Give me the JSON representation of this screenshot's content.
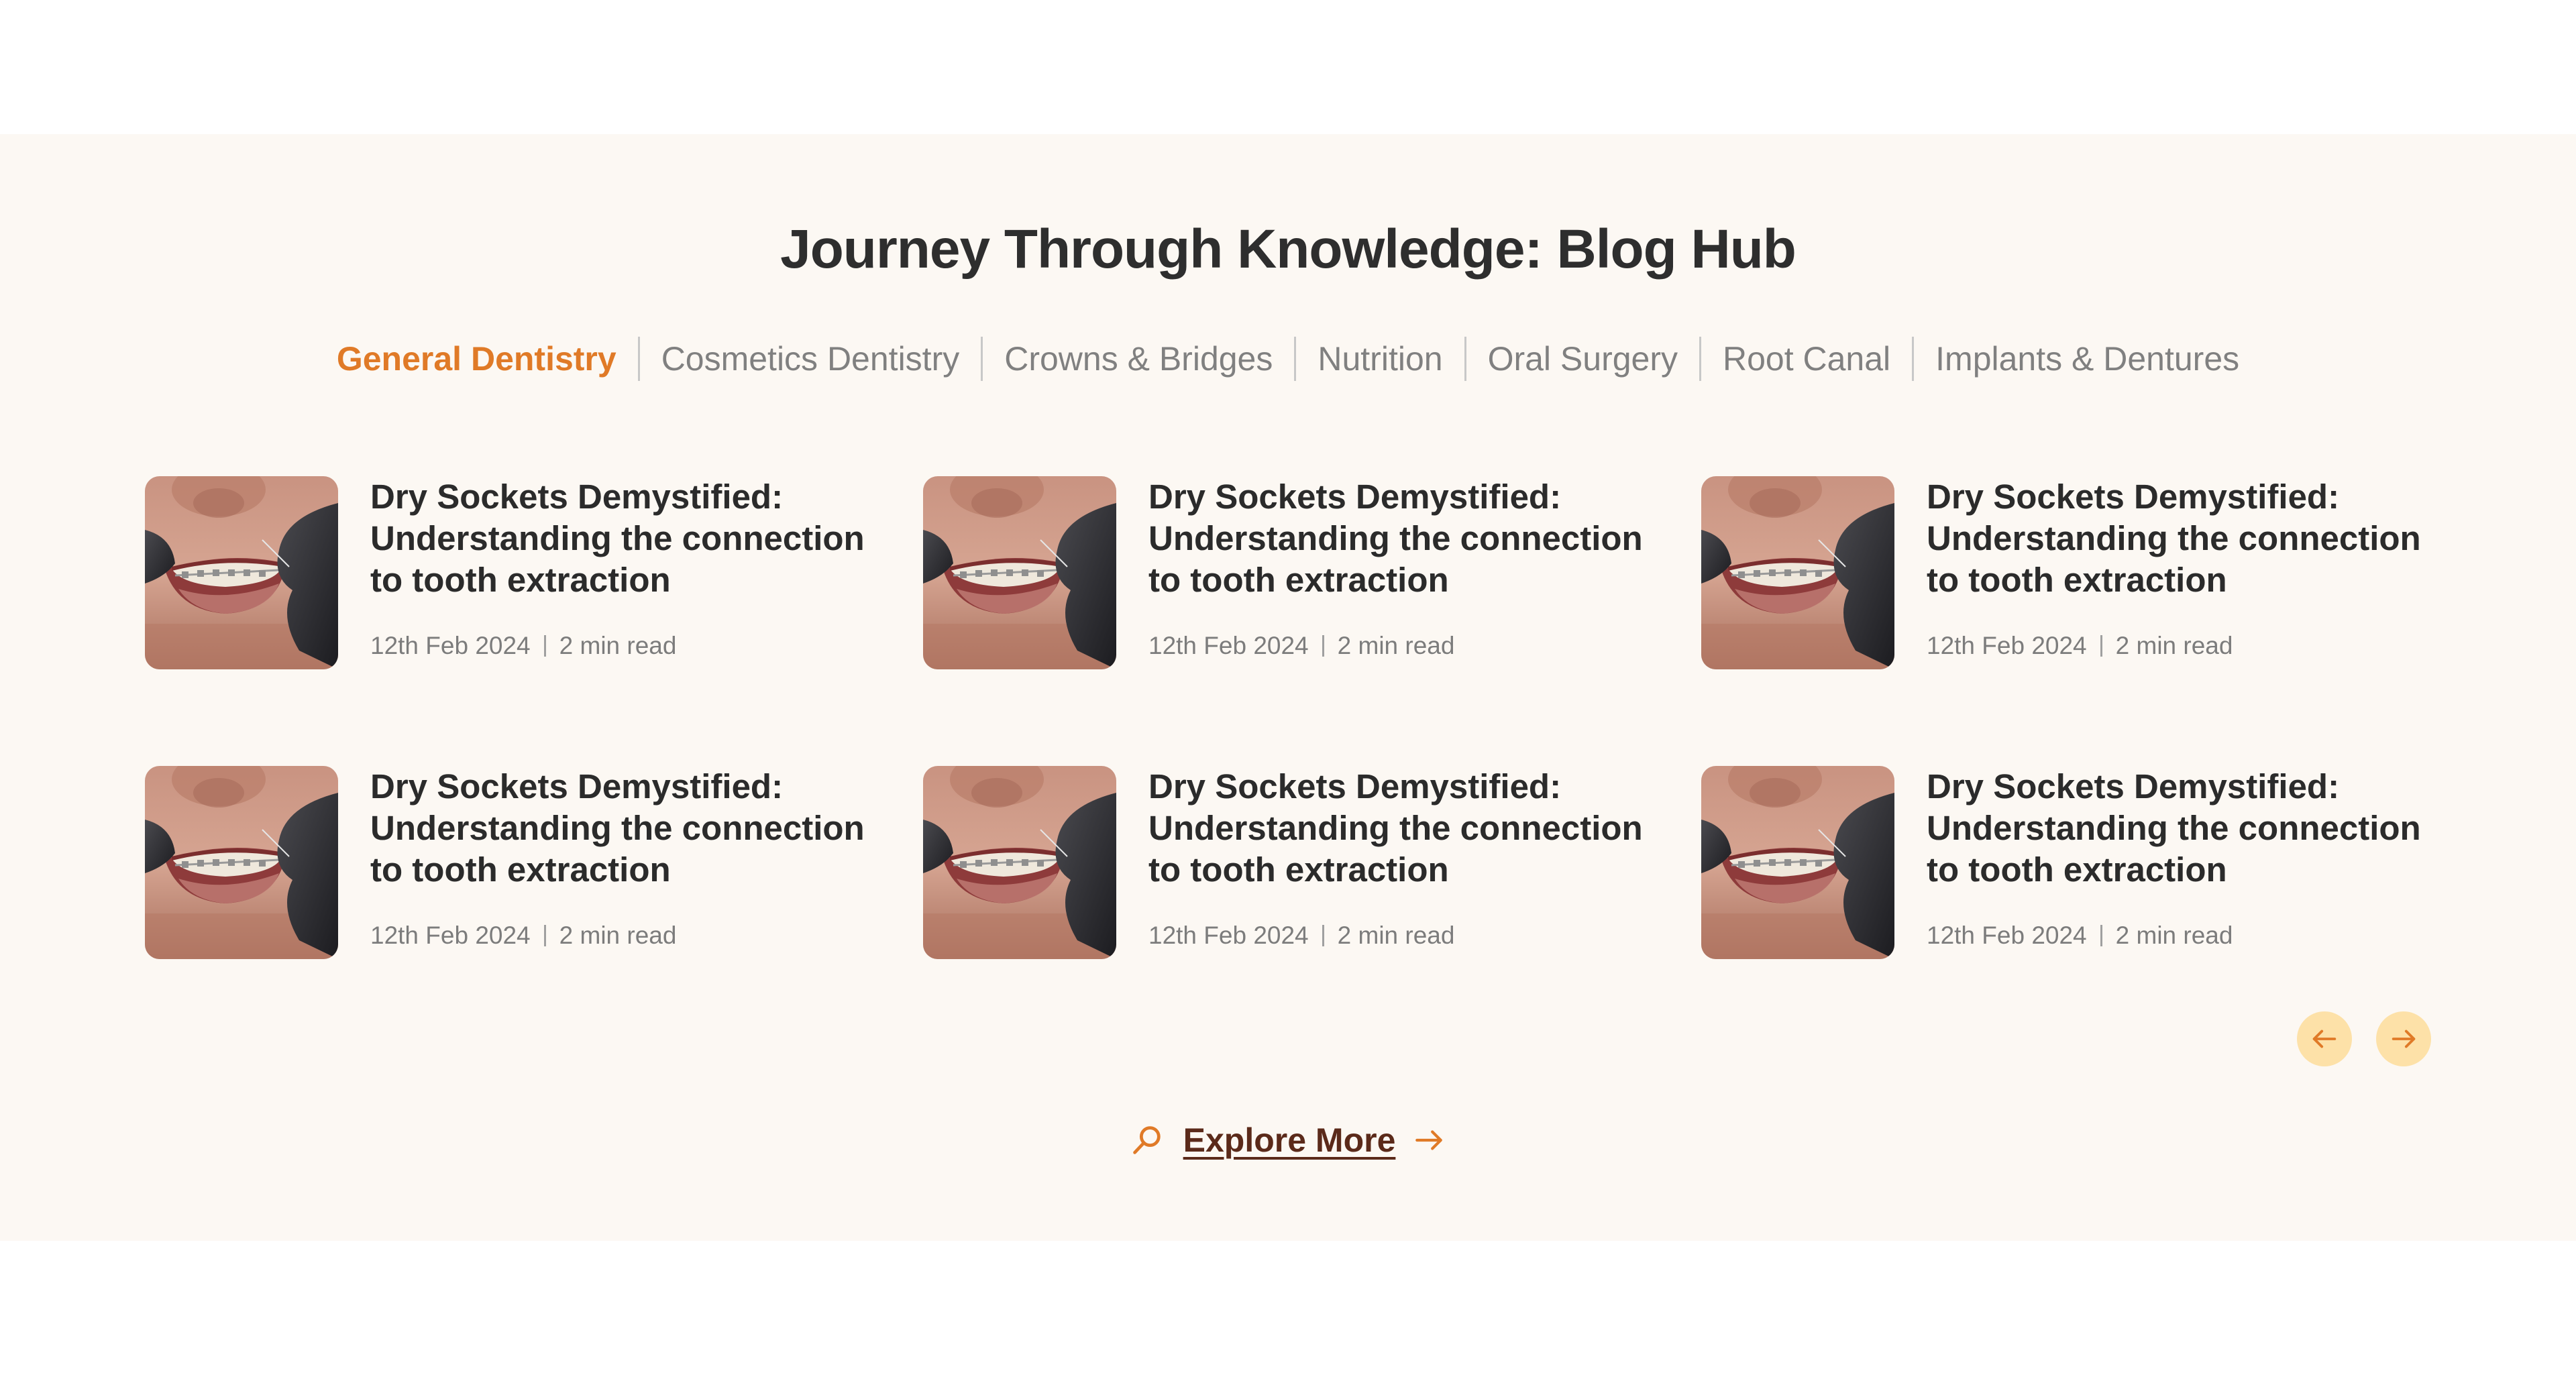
{
  "blog": {
    "heading": "Journey Through Knowledge: Blog Hub",
    "tabs": [
      {
        "label": "General Dentistry",
        "active": true
      },
      {
        "label": "Cosmetics Dentistry",
        "active": false
      },
      {
        "label": "Crowns & Bridges",
        "active": false
      },
      {
        "label": "Nutrition",
        "active": false
      },
      {
        "label": "Oral Surgery",
        "active": false
      },
      {
        "label": "Root Canal",
        "active": false
      },
      {
        "label": "Implants & Dentures",
        "active": false
      }
    ],
    "posts": [
      {
        "title": "Dry Sockets Demystified: Understanding the connection to tooth extraction",
        "date": "12th Feb 2024",
        "read_time": "2 min read",
        "image": "smile-with-braces-photo"
      },
      {
        "title": "Dry Sockets Demystified: Understanding the connection to tooth extraction",
        "date": "12th Feb 2024",
        "read_time": "2 min read",
        "image": "smile-with-braces-photo"
      },
      {
        "title": "Dry Sockets Demystified: Understanding the connection to tooth extraction",
        "date": "12th Feb 2024",
        "read_time": "2 min read",
        "image": "smile-with-braces-photo"
      },
      {
        "title": "Dry Sockets Demystified: Understanding the connection to tooth extraction",
        "date": "12th Feb 2024",
        "read_time": "2 min read",
        "image": "smile-with-braces-photo"
      },
      {
        "title": "Dry Sockets Demystified: Understanding the connection to tooth extraction",
        "date": "12th Feb 2024",
        "read_time": "2 min read",
        "image": "smile-with-braces-photo"
      },
      {
        "title": "Dry Sockets Demystified: Understanding the connection to tooth extraction",
        "date": "12th Feb 2024",
        "read_time": "2 min read",
        "image": "smile-with-braces-photo"
      }
    ],
    "carousel": {
      "prev_icon": "arrow-left-icon",
      "next_icon": "arrow-right-icon"
    },
    "explore": {
      "label": "Explore More",
      "leading_icon": "search-icon",
      "trailing_icon": "arrow-right-icon"
    }
  },
  "colors": {
    "section_bg": "#fcf8f3",
    "accent": "#e07a27",
    "heading": "#2e2e2e",
    "tab_inactive": "#808080",
    "nav_button_bg": "#fde1a8",
    "explore_text": "#5b2a1a"
  }
}
